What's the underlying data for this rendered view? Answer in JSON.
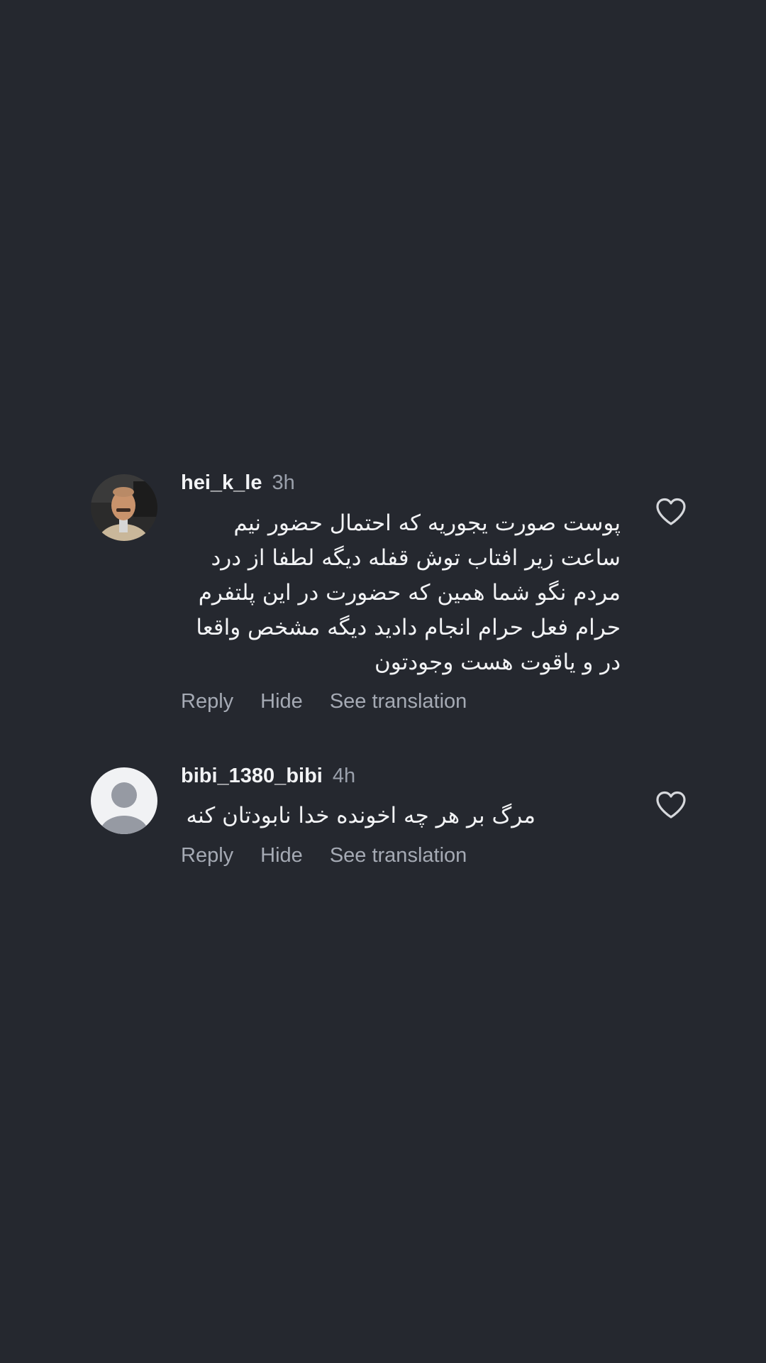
{
  "comments": [
    {
      "username": "hei_k_le",
      "time": "3h",
      "avatar": "user-photo",
      "text": "پوست صورت یجوریه که احتمال حضور نیم ساعت زیر افتاب توش قفله دیگه لطفا از درد مردم نگو شما همین که حضورت در این پلتفرم حرام فعل حرام انجام دادید دیگه مشخص واقعا در و یاقوت هست وجودتون",
      "reply_label": "Reply",
      "hide_label": "Hide",
      "translate_label": "See translation",
      "like_icon": "heart-outline-icon"
    },
    {
      "username": "bibi_1380_bibi",
      "time": "4h",
      "avatar": "default-avatar",
      "text": "مرگ بر هر چه اخونده خدا نابودتان کنه",
      "reply_label": "Reply",
      "hide_label": "Hide",
      "translate_label": "See translation",
      "like_icon": "heart-outline-icon"
    }
  ],
  "colors": {
    "background": "#25282f",
    "text_primary": "#f2f3f5",
    "text_secondary": "#a5aab4"
  }
}
